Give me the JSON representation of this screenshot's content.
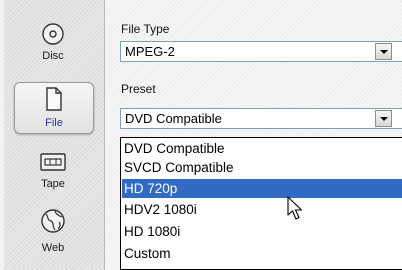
{
  "sidebar": {
    "items": [
      {
        "label": "Disc",
        "icon": "disc-icon",
        "active": false
      },
      {
        "label": "File",
        "icon": "file-icon",
        "active": true
      },
      {
        "label": "Tape",
        "icon": "tape-icon",
        "active": false
      },
      {
        "label": "Web",
        "icon": "web-icon",
        "active": false
      }
    ]
  },
  "main": {
    "file_type": {
      "label": "File Type",
      "value": "MPEG-2"
    },
    "preset": {
      "label": "Preset",
      "value": "DVD Compatible"
    },
    "preset_options": [
      "DVD Compatible",
      "SVCD Compatible",
      "HD 720p",
      "HDV2 1080i",
      "HD 1080i",
      "Custom"
    ],
    "highlighted_option": "HD 720p"
  },
  "colors": {
    "selection": "#316ac5",
    "active_label": "#1f3f9a",
    "combo_border": "#7f9db9"
  }
}
